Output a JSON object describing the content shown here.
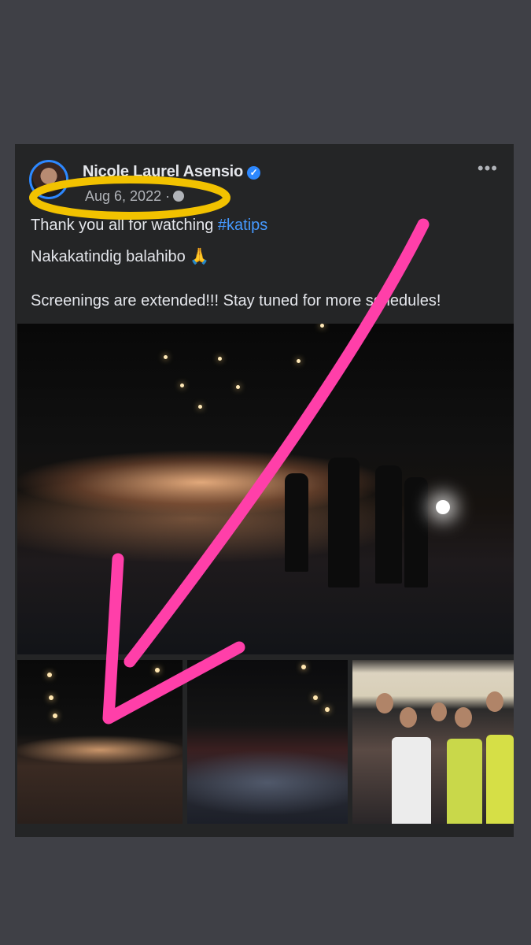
{
  "post": {
    "author": "Nicole Laurel Asensio",
    "date": "Aug 6, 2022 ·",
    "text_prefix": "Thank you all for watching ",
    "hashtag": "#katips",
    "line2": "Nakakatindig balahibo 🙏",
    "line3": "Screenings are extended!!! Stay tuned for more schedules!",
    "more_glyph": "•••",
    "verified_glyph": "✓"
  },
  "icons": {
    "verified": "verified-badge-icon",
    "privacy": "globe-icon",
    "more": "more-options-icon"
  },
  "photos": [
    {
      "name": "theater-audience-wide"
    },
    {
      "name": "theater-audience-left"
    },
    {
      "name": "theater-crowd-center"
    },
    {
      "name": "fans-selfie"
    }
  ],
  "colors": {
    "background": "#3f4046",
    "card": "#242526",
    "text": "#e4e6eb",
    "muted": "#b0b3b8",
    "link": "#4599ff",
    "verified": "#2d88ff",
    "highlight_circle": "#f2c200",
    "arrow": "#ff3fa9"
  }
}
